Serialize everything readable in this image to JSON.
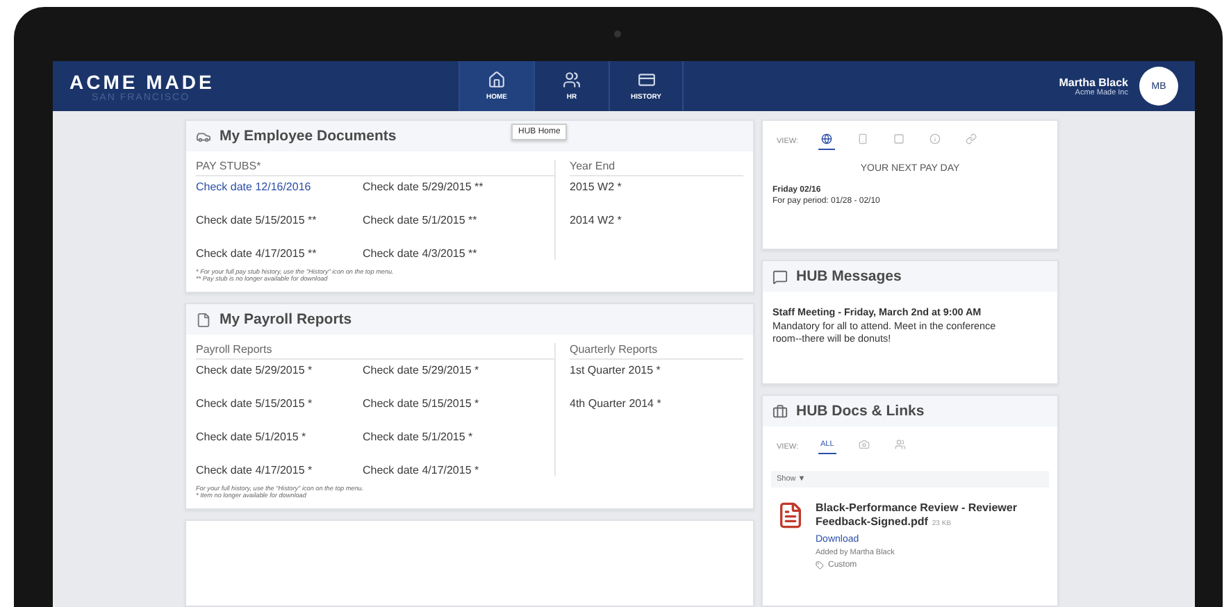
{
  "header": {
    "brand": "ACME MADE",
    "brand_sub": "SAN FRANCISCO",
    "nav": [
      {
        "label": "HOME",
        "selected": true
      },
      {
        "label": "HR",
        "selected": false
      },
      {
        "label": "HISTORY",
        "selected": false
      }
    ],
    "tooltip": "HUB Home",
    "user": {
      "name": "Martha Black",
      "company": "Acme Made Inc",
      "initials": "MB"
    }
  },
  "documents": {
    "title": "My Employee Documents",
    "main": {
      "heading": "PAY STUBS*",
      "items": [
        {
          "label": "Check date 12/16/2016",
          "link": true
        },
        {
          "label": "Check date 5/29/2015 **",
          "link": false
        },
        {
          "label": "Check date 5/15/2015 **",
          "link": false
        },
        {
          "label": "Check date 5/1/2015 **",
          "link": false
        },
        {
          "label": "Check date 4/17/2015 **",
          "link": false
        },
        {
          "label": "Check date 4/3/2015 **",
          "link": false
        }
      ]
    },
    "side": {
      "heading": "Year End",
      "items": [
        {
          "label": "2015 W2 *",
          "link": false
        },
        {
          "label": "2014 W2 *",
          "link": false
        }
      ]
    },
    "notes": [
      "* For your full pay stub history, use the \"History\" icon on the top menu.",
      "** Pay stub is no longer available for download"
    ]
  },
  "payroll": {
    "title": "My Payroll Reports",
    "main": {
      "heading": "Payroll Reports",
      "items": [
        {
          "label": "Check date 5/29/2015 *",
          "link": false
        },
        {
          "label": "Check date 5/29/2015 *",
          "link": false
        },
        {
          "label": "Check date 5/15/2015 *",
          "link": false
        },
        {
          "label": "Check date 5/15/2015 *",
          "link": false
        },
        {
          "label": "Check date 5/1/2015 *",
          "link": false
        },
        {
          "label": "Check date 5/1/2015 *",
          "link": false
        },
        {
          "label": "Check date 4/17/2015 *",
          "link": false
        },
        {
          "label": "Check date 4/17/2015 *",
          "link": false
        }
      ]
    },
    "side": {
      "heading": "Quarterly Reports",
      "items": [
        {
          "label": "1st Quarter 2015 *",
          "link": false
        },
        {
          "label": "4th Quarter 2014 *",
          "link": false
        }
      ]
    },
    "notes": [
      "For your full history, use the \"History\" icon on the top menu.",
      "* Item no longer available for download"
    ]
  },
  "payday": {
    "view_label": "VIEW:",
    "views": [
      {
        "selected": true
      },
      {
        "selected": false
      },
      {
        "selected": false
      },
      {
        "selected": false
      },
      {
        "selected": false
      }
    ],
    "heading": "YOUR NEXT PAY DAY",
    "date": "Friday 02/16",
    "period": "For pay period: 01/28 - 02/10"
  },
  "messages": {
    "title": "HUB Messages",
    "subject": "Staff Meeting - Friday, March 2nd at 9:00 AM",
    "body": "Mandatory for all to attend. Meet in the conference room--there will be donuts!"
  },
  "docs": {
    "title": "HUB Docs & Links",
    "view_label": "VIEW:",
    "views": [
      {
        "label": "ALL",
        "selected": true
      },
      {
        "selected": false
      },
      {
        "selected": false
      }
    ],
    "filter": {
      "label": "Show",
      "caret": "▼"
    },
    "file": {
      "name": "Black-Performance Review - Reviewer Feedback-Signed.pdf",
      "size": "23 KB",
      "action": "Download",
      "added_by": "Added by Martha Black",
      "tag": "Custom"
    }
  }
}
